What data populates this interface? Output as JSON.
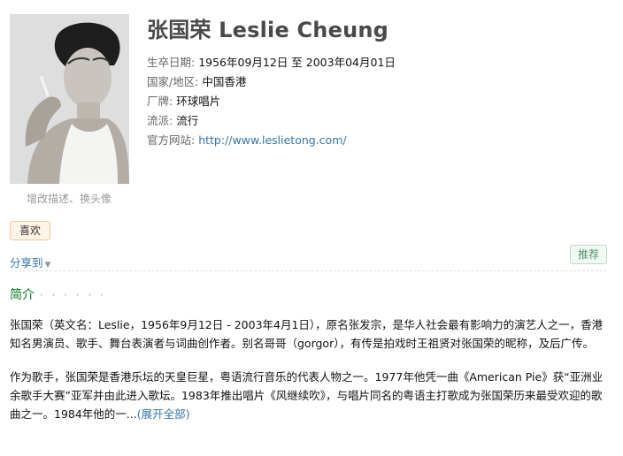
{
  "artist": {
    "name_title": "张国荣 Leslie Cheung",
    "edit_avatar_label": "增改描述、换头像"
  },
  "info": {
    "dates": {
      "label": "生卒日期:",
      "value": "1956年09月12日 至 2003年04月01日"
    },
    "region": {
      "label": "国家/地区:",
      "value": "中国香港"
    },
    "label": {
      "label": "厂牌:",
      "value": "环球唱片"
    },
    "genre": {
      "label": "流派:",
      "value": "流行"
    },
    "website": {
      "label": "官方网站:",
      "value": "http://www.leslietong.com/"
    }
  },
  "actions": {
    "like_label": "喜欢",
    "share_label": "分享到",
    "recommend_label": "推荐"
  },
  "intro": {
    "heading": "简介",
    "dots": "· · · · · ·",
    "paragraph1": "张国荣（英文名：Leslie，1956年9月12日 - 2003年4月1日），原名张发宗，是华人社会最有影响力的演艺人之一，香港知名男演员、歌手、舞台表演者与词曲创作者。别名哥哥（gorgor），有传是拍戏时王祖贤对张国荣的昵称，及后广传。",
    "paragraph2": "作为歌手，张国荣是香港乐坛的天皇巨星，粤语流行音乐的代表人物之一。1977年他凭一曲《American Pie》获“亚洲业余歌手大赛”亚军并由此进入歌坛。1983年推出唱片《风继续吹》，与唱片同名的粤语主打歌成为张国荣历来最受欢迎的歌曲之一。1984年他的一...",
    "expand_label": "(展开全部)"
  },
  "colors": {
    "link": "#3377aa",
    "heading_green": "#007722",
    "recommend_green": "#4f946e",
    "like_bg": "#fff4e5"
  }
}
